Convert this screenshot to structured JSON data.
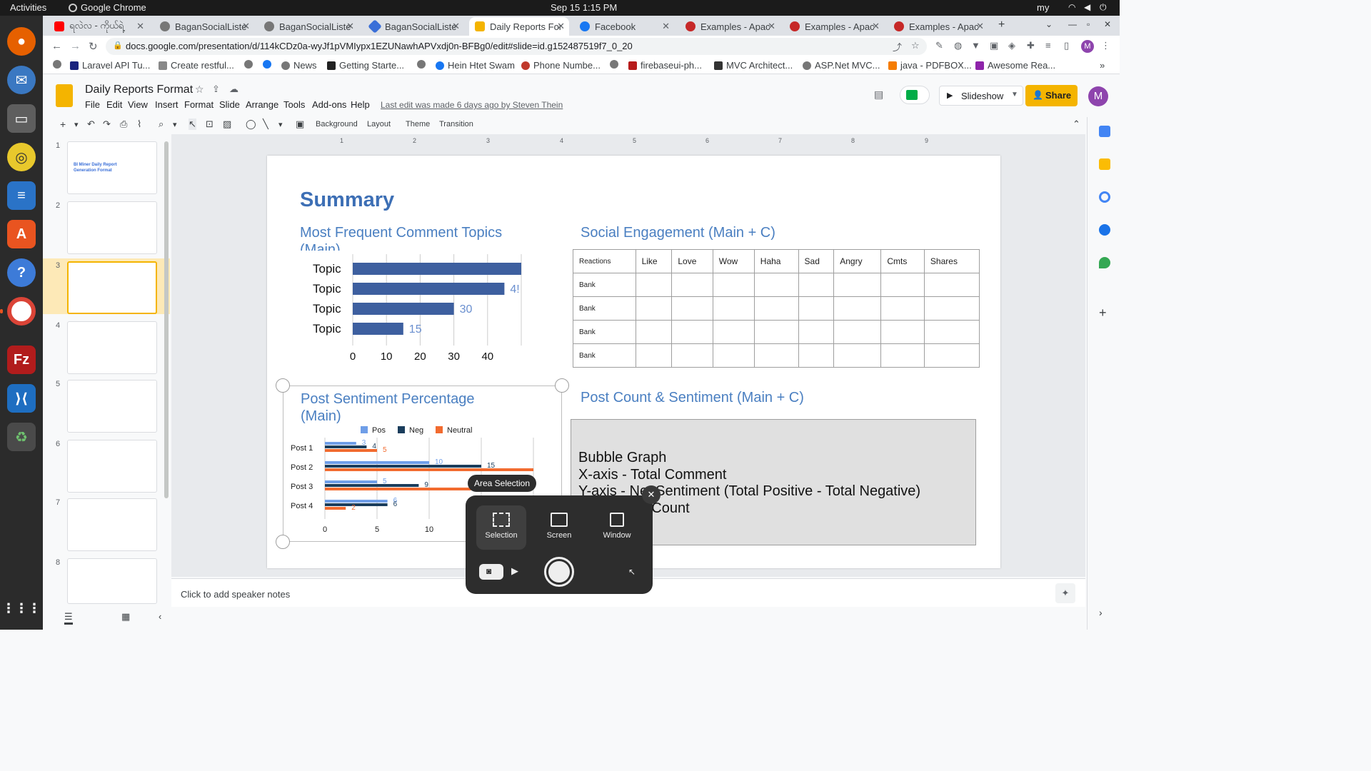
{
  "system": {
    "activities": "Activities",
    "app_name": "Google Chrome",
    "clock": "Sep 15  1:15 PM",
    "lang": "my"
  },
  "tabs": [
    {
      "label": "ရလဲလ - ကိုယ်ရဲ့",
      "active": false
    },
    {
      "label": "BaganSocialListe",
      "active": false
    },
    {
      "label": "BaganSocialListe",
      "active": false
    },
    {
      "label": "BaganSocialListe",
      "active": false
    },
    {
      "label": "Daily Reports For",
      "active": true
    },
    {
      "label": "Facebook",
      "active": false
    },
    {
      "label": "Examples - Apac",
      "active": false
    },
    {
      "label": "Examples - Apac",
      "active": false
    },
    {
      "label": "Examples - Apac",
      "active": false
    }
  ],
  "url": "docs.google.com/presentation/d/114kCDz0a-wyJf1pVMIypx1EZUNawhAPVxdj0n-BFBg0/edit#slide=id.g152487519f7_0_20",
  "bookmarks": [
    "Laravel API Tu...",
    "Create restful...",
    "News",
    "Getting Starte...",
    "Hein Htet Swam",
    "Phone Numbe...",
    "firebaseui-ph...",
    "MVC Architect...",
    "ASP.Net MVC...",
    "java - PDFBOX...",
    "Awesome Rea..."
  ],
  "doc": {
    "title": "Daily Reports Format",
    "menus": [
      "File",
      "Edit",
      "View",
      "Insert",
      "Format",
      "Slide",
      "Arrange",
      "Tools",
      "Add-ons",
      "Help"
    ],
    "last_edit": "Last edit was made 6 days ago by Steven Thein",
    "slideshow": "Slideshow",
    "share": "Share",
    "avatar_letter": "M"
  },
  "toolbar": {
    "background": "Background",
    "layout": "Layout",
    "theme": "Theme",
    "transition": "Transition"
  },
  "ruler_marks": [
    "1",
    "2",
    "3",
    "4",
    "5",
    "6",
    "7",
    "8",
    "9"
  ],
  "filmstrip": {
    "numbers": [
      "1",
      "2",
      "3",
      "4",
      "5",
      "6",
      "7",
      "8"
    ],
    "slide1_title": "BI Miner Daily Report Generation Format"
  },
  "slide": {
    "title": "Summary",
    "topics_heading": "Most Frequent Comment Topics",
    "topics_heading_cut": "(Main)",
    "engagement_heading": "Social Engagement (Main + C)",
    "sentiment_heading_1": "Post Sentiment Percentage",
    "sentiment_heading_2": "(Main)",
    "postcount_heading": "Post Count & Sentiment (Main + C)",
    "engagement_columns": [
      "Reactions",
      "Like",
      "Love",
      "Wow",
      "Haha",
      "Sad",
      "Angry",
      "Cmts",
      "Shares"
    ],
    "engagement_rows": [
      "Bank",
      "Bank",
      "Bank",
      "Bank"
    ],
    "bubble_text": [
      "Bubble Graph",
      "X-axis - Total Comment",
      "Y-axis - Net Sentiment (Total Positive - Total Negative)",
      "Size - Post Count"
    ]
  },
  "chart_data": [
    {
      "type": "bar",
      "orientation": "horizontal",
      "categories": [
        "Topic",
        "Topic",
        "Topic",
        "Topic"
      ],
      "values": [
        50,
        45,
        30,
        15
      ],
      "data_labels": [
        "",
        "4!",
        "30",
        "15"
      ],
      "xlim": [
        0,
        50
      ],
      "xticks": [
        "0",
        "10",
        "20",
        "30",
        "40"
      ],
      "color": "#3d5f9f"
    },
    {
      "type": "bar",
      "orientation": "horizontal",
      "categories": [
        "Post 1",
        "Post 2",
        "Post 3",
        "Post 4"
      ],
      "series": [
        {
          "name": "Pos",
          "values": [
            3,
            10,
            5,
            6
          ],
          "color": "#6f9ee8"
        },
        {
          "name": "Neg",
          "values": [
            4,
            15,
            9,
            6
          ],
          "color": "#1a3d5c"
        },
        {
          "name": "Neutral",
          "values": [
            5,
            20,
            14,
            2
          ],
          "color": "#f26b2f"
        }
      ],
      "data_labels": [
        [
          "3",
          "10",
          "5",
          "6"
        ],
        [
          "4",
          "15",
          "9",
          "6"
        ],
        [
          "5",
          "",
          "14",
          "2"
        ]
      ],
      "xlim": [
        0,
        20
      ],
      "xticks": [
        "0",
        "5",
        "10"
      ],
      "legend": "top"
    }
  ],
  "capture": {
    "tooltip": "Area Selection",
    "modes": [
      "Selection",
      "Screen",
      "Window"
    ]
  },
  "notes": "Click to add speaker notes"
}
